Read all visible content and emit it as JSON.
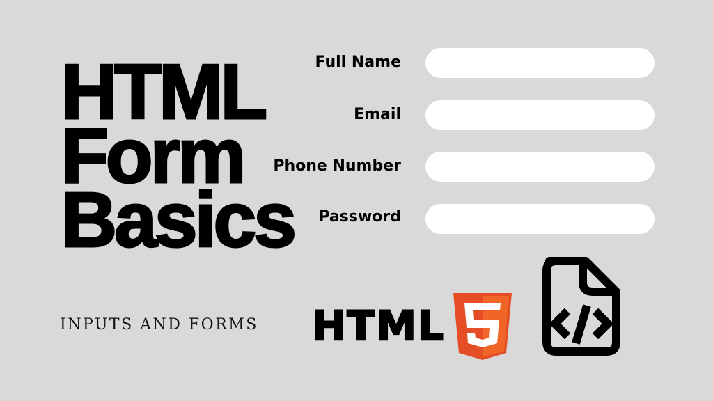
{
  "title": {
    "line1": "HTML",
    "line2": "Form",
    "line3": "Basics"
  },
  "subtitle": "INPUTS AND FORMS",
  "form": {
    "fields": [
      {
        "label": "Full Name",
        "value": "",
        "placeholder": ""
      },
      {
        "label": "Email",
        "value": "",
        "placeholder": ""
      },
      {
        "label": "Phone Number",
        "value": "",
        "placeholder": ""
      },
      {
        "label": "Password",
        "value": "",
        "placeholder": ""
      }
    ]
  },
  "logo": {
    "word": "HTML",
    "badge": "5",
    "badge_colors": {
      "left": "#e44d26",
      "right": "#f16529",
      "glyph": "#ffffff"
    }
  },
  "icons": {
    "html5": "html5-shield-icon",
    "file": "file-code-icon"
  },
  "colors": {
    "background": "#d9d9d9",
    "text": "#000000",
    "field": "#ffffff"
  }
}
